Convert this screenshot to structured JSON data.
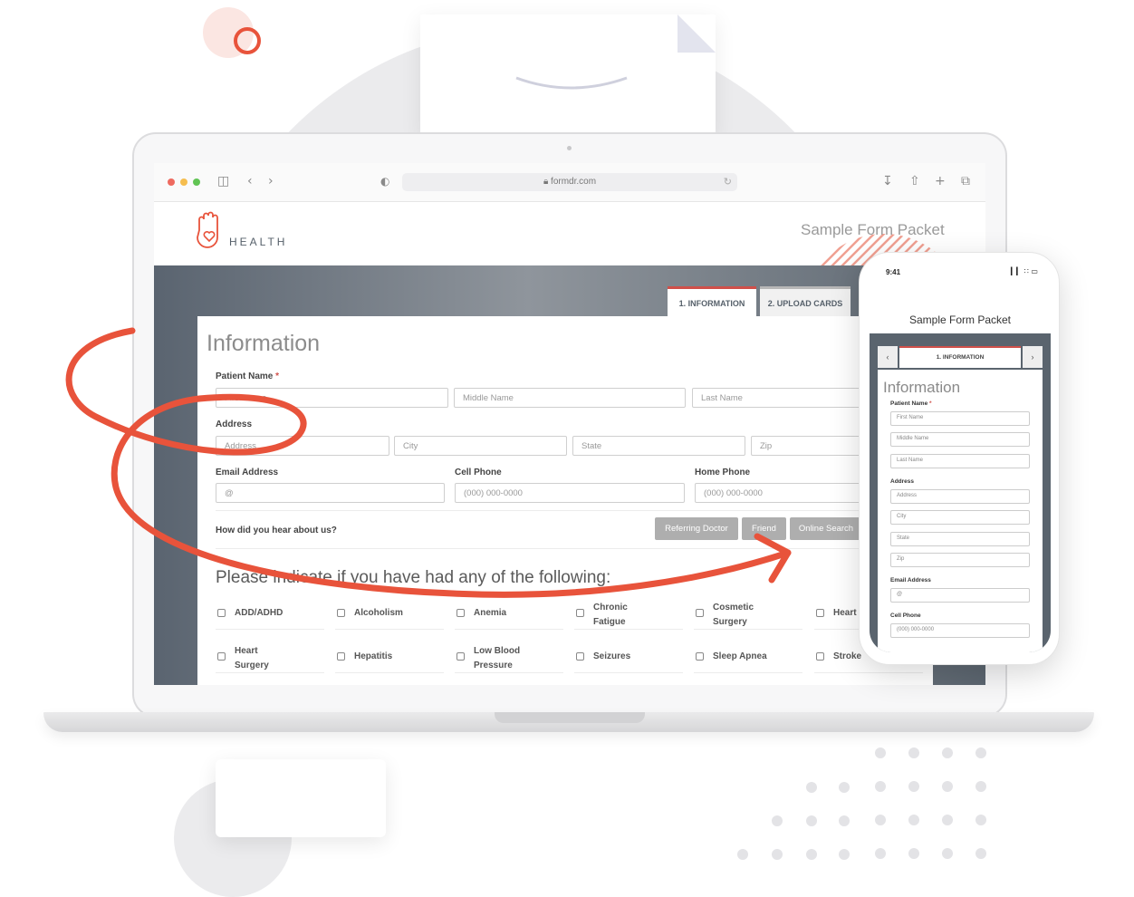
{
  "browser": {
    "url": "formdr.com",
    "traffic_colors": [
      "#ee6a5f",
      "#f5bd4f",
      "#61c454"
    ]
  },
  "site": {
    "logo_text": "HEALTH",
    "packet_title": "Sample Form Packet",
    "accent_color": "#e8533b"
  },
  "tabs": [
    {
      "label": "1. INFORMATION",
      "active": true
    },
    {
      "label": "2. UPLOAD CARDS",
      "active": false
    }
  ],
  "form": {
    "title": "Information",
    "patient_name": {
      "label": "Patient Name",
      "required_mark": "*",
      "placeholders": [
        "First Name",
        "Middle Name",
        "Last Name"
      ]
    },
    "address": {
      "label": "Address",
      "placeholders": [
        "Address",
        "City",
        "State",
        "Zip"
      ]
    },
    "email": {
      "label": "Email Address",
      "placeholder": "@"
    },
    "cell_phone": {
      "label": "Cell Phone",
      "placeholder": "(000) 000-0000"
    },
    "home_phone": {
      "label": "Home Phone",
      "placeholder": "(000) 000-0000"
    },
    "referral": {
      "question": "How did you hear about us?",
      "options": [
        "Referring Doctor",
        "Friend",
        "Online Search"
      ]
    },
    "conditions_heading": "Please indicate if you have had any of the following:",
    "conditions": [
      [
        "ADD/ADHD",
        "Alcoholism",
        "Anemia",
        "Chronic Fatigue",
        "Cosmetic Surgery",
        "Heart"
      ],
      [
        "Heart Surgery",
        "Hepatitis",
        "Low Blood Pressure",
        "Seizures",
        "Sleep Apnea",
        "Stroke"
      ]
    ]
  },
  "phone": {
    "time": "9:41",
    "status_icons": "▎▎ ∷ ▭",
    "title": "Sample Form Packet",
    "tab_label": "1. INFORMATION",
    "nav_prev": "‹",
    "nav_next": "›",
    "form_title": "Information",
    "patient_name_label": "Patient Name",
    "required_mark": "*",
    "name_placeholders": [
      "First Name",
      "Middle Name",
      "Last Name"
    ],
    "address_label": "Address",
    "address_placeholders": [
      "Address",
      "City",
      "State",
      "Zip"
    ],
    "email_label": "Email Address",
    "email_placeholder": "@",
    "cell_label": "Cell Phone",
    "cell_placeholder": "(000) 000-0000"
  }
}
